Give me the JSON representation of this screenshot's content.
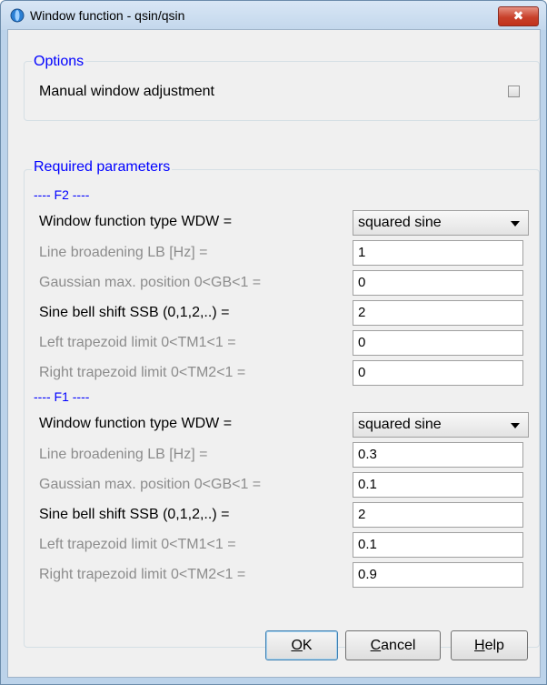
{
  "window": {
    "title": "Window function - qsin/qsin",
    "close_glyph": "✖"
  },
  "options": {
    "legend": "Options",
    "manual_label": "Manual window adjustment",
    "manual_checked": false
  },
  "required": {
    "legend": "Required parameters",
    "f2": {
      "header": "---- F2 ----",
      "wdw_label": "Window function type WDW =",
      "wdw_value": "squared sine",
      "lb_label": "Line broadening LB [Hz] =",
      "lb_value": "1",
      "gb_label": "Gaussian max. position 0<GB<1 =",
      "gb_value": "0",
      "ssb_label": "Sine bell shift SSB (0,1,2,..) =",
      "ssb_value": "2",
      "tm1_label": "Left trapezoid limit 0<TM1<1 =",
      "tm1_value": "0",
      "tm2_label": "Right trapezoid limit 0<TM2<1 =",
      "tm2_value": "0"
    },
    "f1": {
      "header": "---- F1 ----",
      "wdw_label": "Window function type WDW =",
      "wdw_value": "squared sine",
      "lb_label": "Line broadening LB [Hz] =",
      "lb_value": "0.3",
      "gb_label": "Gaussian max. position 0<GB<1 =",
      "gb_value": "0.1",
      "ssb_label": "Sine bell shift SSB (0,1,2,..) =",
      "ssb_value": "2",
      "tm1_label": "Left trapezoid limit 0<TM1<1 =",
      "tm1_value": "0.1",
      "tm2_label": "Right trapezoid limit 0<TM2<1 =",
      "tm2_value": "0.9"
    }
  },
  "buttons": {
    "ok": {
      "mnemonic": "O",
      "rest": "K"
    },
    "cancel": {
      "mnemonic": "C",
      "rest": "ancel"
    },
    "help": {
      "mnemonic": "H",
      "rest": "elp"
    }
  },
  "colors": {
    "legend": "#0000ff",
    "disabled_label": "#8c8c8c",
    "close": "#c8412b"
  }
}
